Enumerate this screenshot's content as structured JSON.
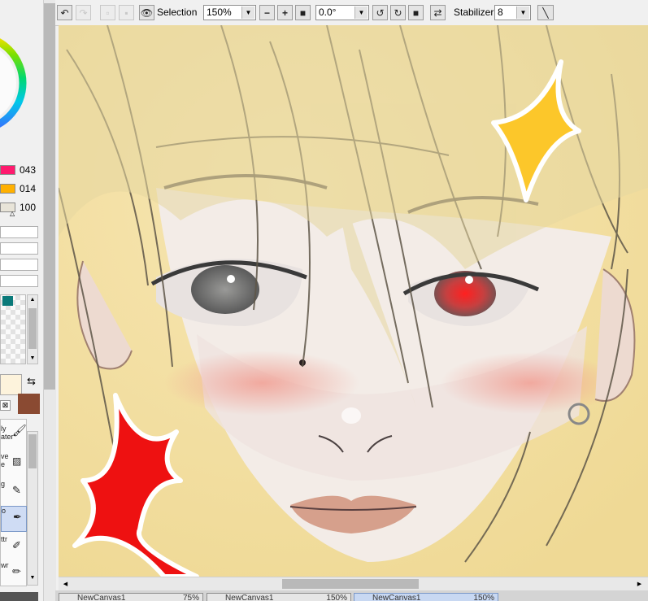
{
  "toolbar": {
    "selection_label": "Selection",
    "zoom_value": "150%",
    "rotation_value": "0.0°",
    "stabilizer_label": "Stabilizer",
    "stabilizer_value": "8"
  },
  "color_panel": {
    "sliders": [
      {
        "value": "043",
        "color": "#ff1a6e"
      },
      {
        "value": "014",
        "color": "#ffb000"
      },
      {
        "value": "100",
        "color": "#e8e4d8"
      }
    ],
    "primary_color": "#fdf3dc",
    "secondary_color": "#8a4a32",
    "swatch_teal": "#0b7a7a"
  },
  "tools": [
    {
      "label": "ly",
      "label2": "ater",
      "icon": "brush-icon"
    },
    {
      "label": "ve",
      "label2": "e",
      "icon": "smudge-icon"
    },
    {
      "label": "g",
      "label2": "",
      "icon": "pencil-icon"
    },
    {
      "label": "o",
      "label2": "",
      "icon": "pen-icon",
      "selected": true
    },
    {
      "label": "ttr",
      "label2": "",
      "icon": "eraser-icon"
    },
    {
      "label": "wr",
      "label2": "",
      "icon": "marker-icon"
    }
  ],
  "tabs": [
    {
      "name": "NewCanvas1",
      "zoom": "75%"
    },
    {
      "name": "NewCanvas1",
      "zoom": "150%"
    },
    {
      "name": "NewCanvas1",
      "zoom": "150%",
      "active": true
    }
  ]
}
